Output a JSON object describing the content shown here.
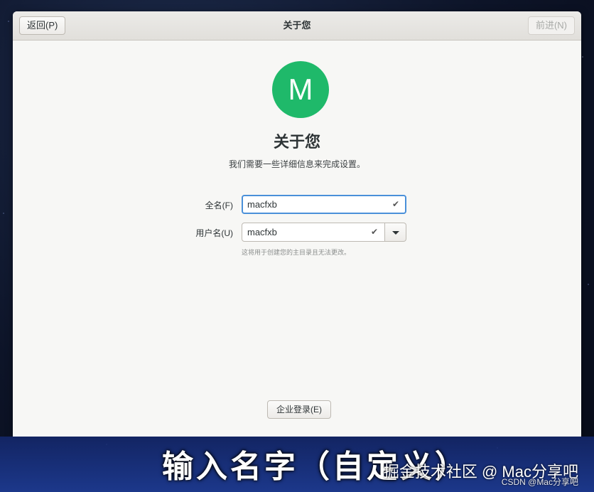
{
  "window": {
    "title": "关于您",
    "back_label": "返回(P)",
    "next_label": "前进(N)"
  },
  "avatar": {
    "letter": "M",
    "color": "#1fb96a"
  },
  "page": {
    "title": "关于您",
    "subtitle": "我们需要一些详细信息来完成设置。"
  },
  "form": {
    "fullname_label": "全名(F)",
    "fullname_value": "macfxb",
    "username_label": "用户名(U)",
    "username_value": "macfxb",
    "username_hint": "这将用于创建您的主目录且无法更改。",
    "check_icon": "✔"
  },
  "enterprise_button_label": "企业登录(E)",
  "overlay": {
    "caption": "输入名字（自定义）",
    "watermark_main": "掘金技术社区 @ Mac分享吧",
    "watermark_sub": "CSDN @Mac分享吧"
  },
  "colors": {
    "accent_focus": "#4a90d9",
    "avatar_bg": "#1fb96a"
  }
}
